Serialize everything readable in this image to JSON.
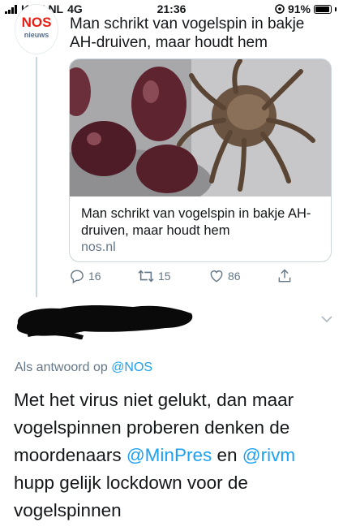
{
  "status_bar": {
    "carrier": "KPN NL",
    "network": "4G",
    "time": "21:36",
    "battery": "91%",
    "battery_level": 0.91
  },
  "tweet1": {
    "avatar_logo": "NOS",
    "avatar_sub": "nieuws",
    "text": "Man schrikt van vogelspin in bakje AH-druiven, maar houdt hem",
    "card": {
      "title": "Man schrikt van vogelspin in bakje AH-druiven, maar houdt hem",
      "domain": "nos.nl"
    },
    "actions": {
      "replies": "16",
      "retweets": "15",
      "likes": "86"
    }
  },
  "tweet2": {
    "reply_prefix": "Als antwoord op",
    "reply_handle": "@NOS",
    "text_part1": "Met het virus niet gelukt, dan maar vogelspinnen proberen denken de moordenaars",
    "mention1": "@MinPres",
    "text_part2": "en",
    "mention2": "@rivm",
    "text_part3": "hupp gelijk lockdown voor de vogelspinnen"
  },
  "colors": {
    "link": "#1da1f2",
    "secondary_text": "#657786",
    "nos_red": "#e61e14"
  },
  "icons": [
    "signal-icon",
    "location-icon",
    "battery-icon",
    "reply-icon",
    "retweet-icon",
    "like-icon",
    "share-icon",
    "chevron-down-icon"
  ]
}
